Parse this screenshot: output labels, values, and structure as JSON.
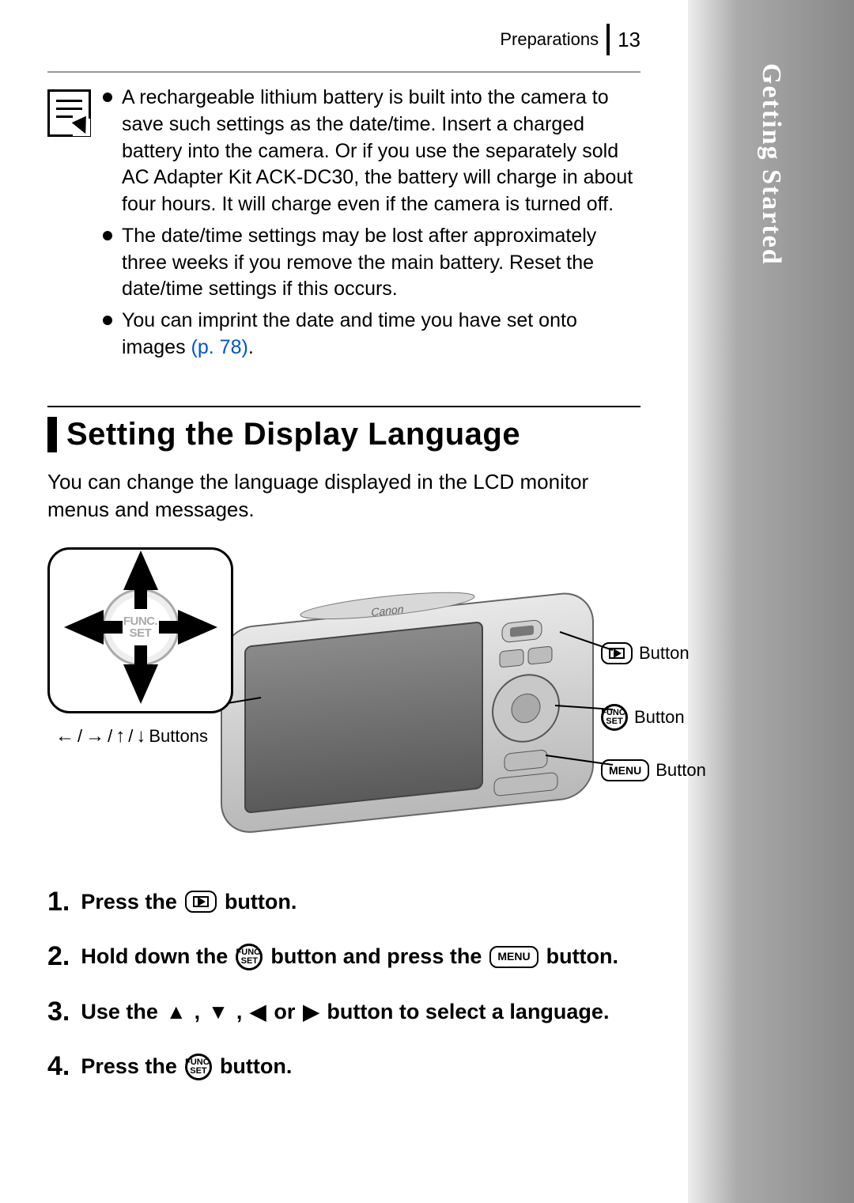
{
  "header": {
    "section_label": "Preparations",
    "page_number": "13"
  },
  "side_tab": "Getting Started",
  "note_box": {
    "items": [
      {
        "text": "A rechargeable lithium battery is built into the camera to save such settings as the date/time. Insert a charged battery into the camera. Or if you use the separately sold AC Adapter Kit ACK-DC30, the battery will charge in about four hours. It will charge even if the camera is turned off."
      },
      {
        "text": "The date/time settings may be lost after approximately three weeks if you remove the main battery. Reset the date/time settings if this occurs."
      },
      {
        "text": "You can imprint the date and time you have set onto images ",
        "link": "(p. 78)",
        "suffix": "."
      }
    ]
  },
  "section": {
    "title": "Setting the Display Language",
    "intro": "You can change the language displayed in the LCD monitor menus and messages."
  },
  "diagram": {
    "funcset_label_top": "FUNC.",
    "funcset_label_bottom": "SET",
    "arrows_buttons_word": "Buttons",
    "labels": {
      "playback": "Button",
      "funcset": "Button",
      "menu": "Button",
      "menu_word": "MENU"
    }
  },
  "steps": [
    {
      "num": "1.",
      "parts": [
        "Press the ",
        {
          "icon": "play"
        },
        " button."
      ]
    },
    {
      "num": "2.",
      "parts": [
        "Hold down the ",
        {
          "icon": "funcset"
        },
        " button and press the ",
        {
          "icon": "menu"
        },
        " button."
      ]
    },
    {
      "num": "3.",
      "parts": [
        "Use the ",
        {
          "icon": "up"
        },
        ", ",
        {
          "icon": "down"
        },
        ", ",
        {
          "icon": "left"
        },
        " or ",
        {
          "icon": "right"
        },
        " button to select a language."
      ]
    },
    {
      "num": "4.",
      "parts": [
        "Press the ",
        {
          "icon": "funcset"
        },
        " button."
      ]
    }
  ]
}
